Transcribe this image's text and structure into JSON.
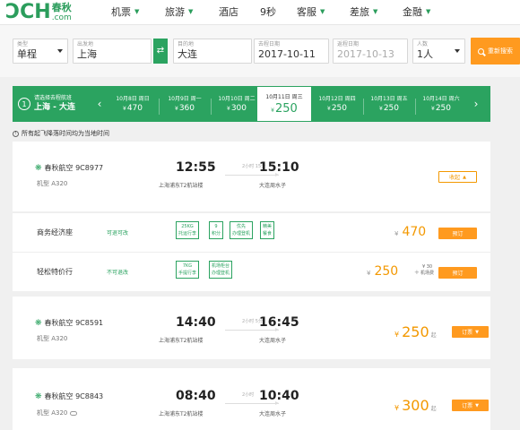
{
  "header": {
    "logo_mark": "ƆCH",
    "logo_cn": "春秋",
    "logo_com": ".com",
    "nav": [
      {
        "label": "机票",
        "chevron": true
      },
      {
        "label": "旅游",
        "chevron": true
      },
      {
        "label": "酒店",
        "chevron": false
      },
      {
        "label": "9秒",
        "chevron": false
      },
      {
        "label": "客服",
        "chevron": true
      },
      {
        "label": "差旅",
        "chevron": true
      },
      {
        "label": "金融",
        "chevron": true
      }
    ]
  },
  "search": {
    "type_label": "类型",
    "type_value": "单程",
    "from_label": "出发地",
    "from_value": "上海",
    "to_label": "目的地",
    "to_value": "大连",
    "depart_label": "去程日期",
    "depart_value": "2017-10-11",
    "return_label": "返程日期",
    "return_value": "2017-10-13",
    "pax_label": "人数",
    "pax_value": "1人",
    "search_button": "重新搜索",
    "swap_glyph": "⇄"
  },
  "date_strip": {
    "step": "1",
    "hint": "请选择去程航班",
    "route": "上海 - 大连",
    "prev": "‹",
    "next": "›",
    "currency": "¥",
    "days": [
      {
        "label": "10月8日 周日",
        "price": "470",
        "active": false
      },
      {
        "label": "10月9日 周一",
        "price": "360",
        "active": false
      },
      {
        "label": "10月10日 周二",
        "price": "300",
        "active": false
      },
      {
        "label": "10月11日 周三",
        "price": "250",
        "active": true
      },
      {
        "label": "10月12日 周四",
        "price": "250",
        "active": false
      },
      {
        "label": "10月13日 周五",
        "price": "250",
        "active": false
      },
      {
        "label": "10月14日 周六",
        "price": "250",
        "active": false
      }
    ]
  },
  "tz_note": "所有起飞降落时间均为当地时间",
  "tz_icon": "!",
  "flights": [
    {
      "airline": "春秋航空 9C8977",
      "plane": "机型 A320",
      "dep_time": "12:55",
      "arr_time": "15:10",
      "duration": "2小时 15分",
      "dep_airport": "上海浦东T2航站楼",
      "arr_airport": "大连周水子",
      "collapse_label": "收起",
      "fares": [
        {
          "name": "商务经济座",
          "rule": "可退可改",
          "tags": [
            [
              "25KG",
              "托运行李"
            ],
            [
              "9",
              "积分"
            ],
            [
              "优先",
              "办理登机"
            ],
            [
              "精美",
              "餐食"
            ]
          ],
          "price": "470",
          "book": "预订"
        },
        {
          "name": "轻松特价行",
          "rule": "不可退改",
          "tags": [
            [
              "7KG",
              "手提行李"
            ],
            [
              "机场柜台",
              "办理登机"
            ]
          ],
          "price": "250",
          "fee_amount": "¥ 30",
          "fee_label": "机场费",
          "book": "预订"
        }
      ]
    },
    {
      "airline": "春秋航空 9C8591",
      "plane": "机型 A320",
      "dep_time": "14:40",
      "arr_time": "16:45",
      "duration": "2小时 5分",
      "dep_airport": "上海浦东T2航站楼",
      "arr_airport": "大连周水子",
      "price": "250",
      "from_label": "起",
      "book": "订票"
    },
    {
      "airline": "春秋航空 9C8843",
      "plane": "机型 A320",
      "dep_time": "08:40",
      "arr_time": "10:40",
      "duration": "2小时",
      "dep_airport": "上海浦东T2航站楼",
      "arr_airport": "大连周水子",
      "price": "300",
      "from_label": "起",
      "book": "订票"
    }
  ],
  "colors": {
    "brand_green": "#2ba360",
    "accent_orange": "#ff9a1f",
    "price_orange": "#f39800"
  }
}
